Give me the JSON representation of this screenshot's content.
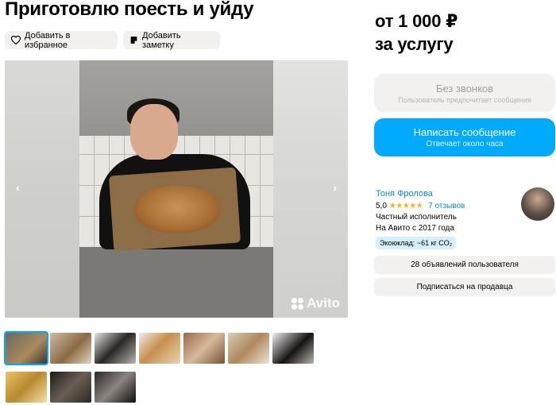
{
  "listing": {
    "title": "Приготовлю поесть и уйду",
    "actions": {
      "favorite_label": "Добавить в избранное",
      "note_label": "Добавить заметку"
    },
    "gallery": {
      "watermark": "Avito",
      "prev_icon": "chevron-left-icon",
      "next_icon": "chevron-right-icon",
      "thumbnails_row1": 7,
      "thumbnails_row2": 3,
      "active_index": 0
    }
  },
  "sidebar": {
    "price_line1": "от 1 000 ₽",
    "price_line2": "за услугу",
    "no_calls": {
      "title": "Без звонков",
      "subtitle": "Пользователь предпочитает сообщения"
    },
    "message": {
      "title": "Написать сообщение",
      "subtitle": "Отвечает около часа"
    },
    "seller": {
      "name": "Тоня Фролова",
      "rating": "5,0",
      "stars": "★★★★★",
      "reviews": "7 отзывов",
      "type": "Частный исполнитель",
      "since": "На Авито с 2017 года",
      "eco": "Экоюклад: ~61 кг CO₂"
    },
    "ads_button": "28 объявлений пользователя",
    "subscribe_button": "Подписаться на продавца"
  },
  "colors": {
    "accent": "#00aaff",
    "link": "#0a8ad6",
    "star": "#ffb020",
    "button_bg": "#f2f1f0",
    "eco_bg": "#d6efff"
  }
}
